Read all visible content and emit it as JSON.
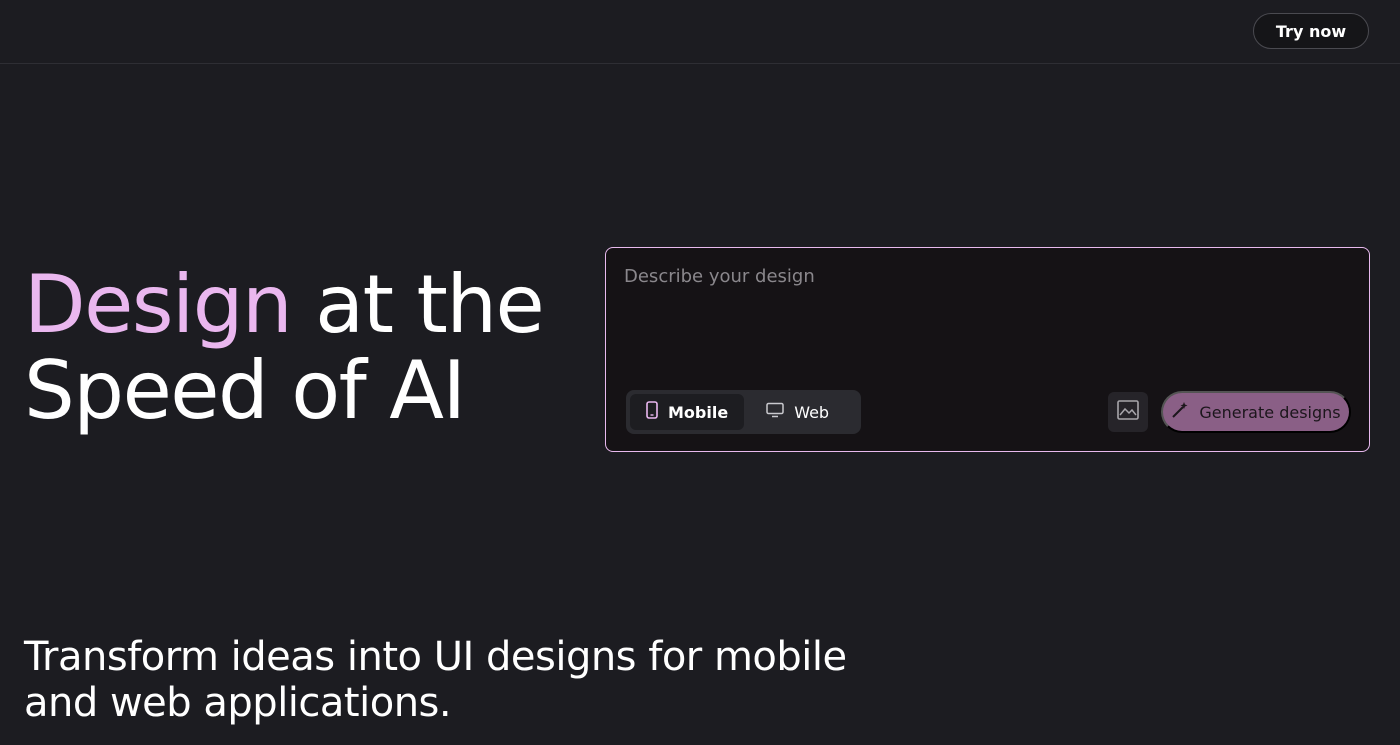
{
  "header": {
    "try_now_label": "Try now"
  },
  "hero": {
    "accent_word": "Design",
    "rest_line1": " at the",
    "line2": "Speed of AI"
  },
  "prompt": {
    "placeholder": "Describe your design",
    "value": "",
    "device_options": [
      {
        "label": "Mobile",
        "icon": "phone-icon",
        "active": true
      },
      {
        "label": "Web",
        "icon": "monitor-icon",
        "active": false
      }
    ],
    "image_button_icon": "image-icon",
    "generate_label": "Generate designs",
    "generate_icon": "magic-wand-icon"
  },
  "subtitle": "Transform ideas into UI designs for mobile and web applications.",
  "colors": {
    "background": "#1c1c21",
    "accent": "#eab7ef",
    "generate_button": "#8a5f86"
  }
}
